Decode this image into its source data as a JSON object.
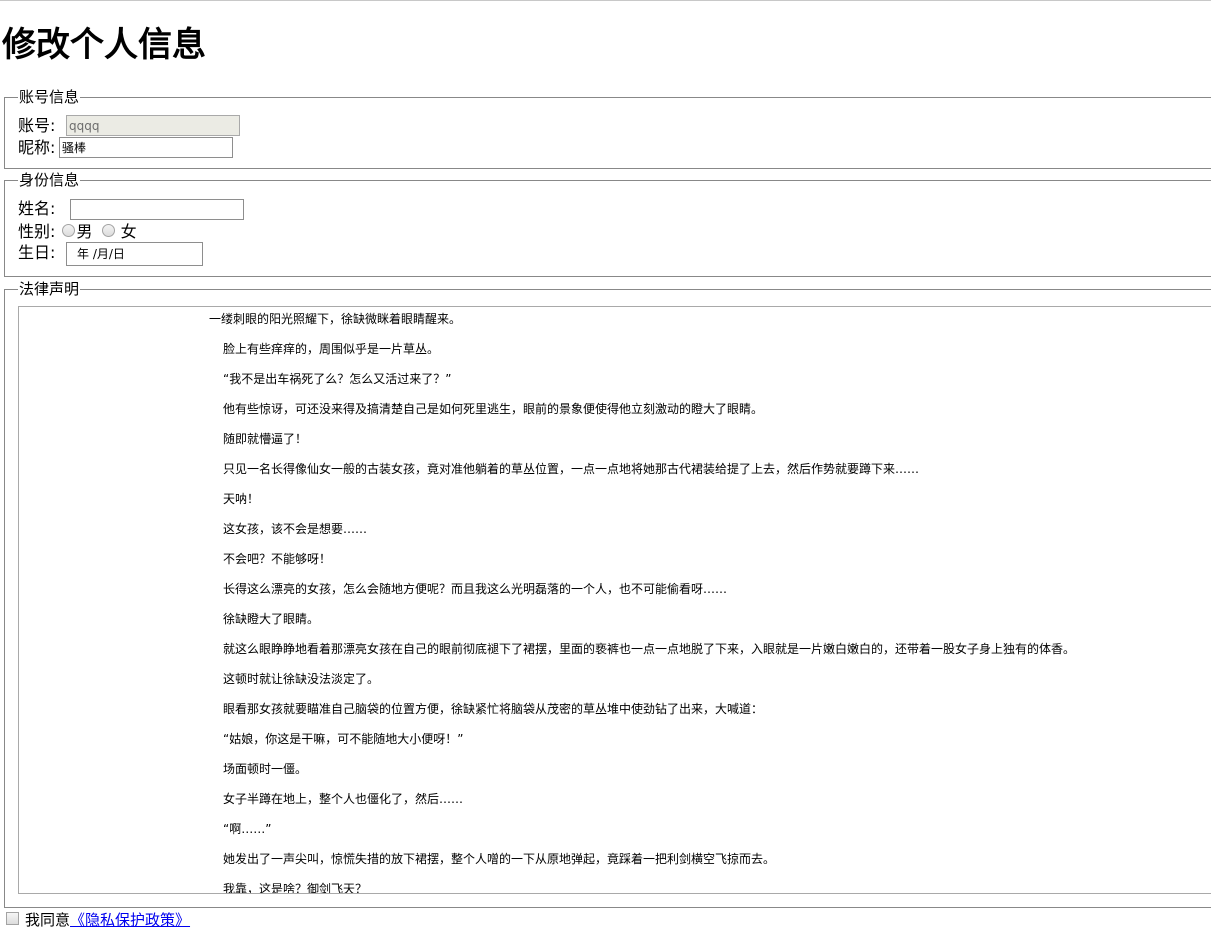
{
  "page": {
    "title": "修改个人信息"
  },
  "account_section": {
    "legend": "账号信息",
    "account_label": "账号:",
    "account_value": "qqqq",
    "nickname_label": "昵称:",
    "nickname_value": "骚棒"
  },
  "identity_section": {
    "legend": "身份信息",
    "name_label": "姓名:",
    "name_value": "",
    "gender_label": "性别:",
    "gender_options": [
      "男",
      "女"
    ],
    "birthday_label": "生日:",
    "birthday_placeholder": "年 /月/日"
  },
  "legal_section": {
    "legend": "法律声明",
    "paragraphs": [
      "一缕刺眼的阳光照耀下，徐缺微眯着眼睛醒来。",
      "脸上有些痒痒的，周围似乎是一片草丛。",
      "“我不是出车祸死了么？怎么又活过来了？”",
      "他有些惊讶，可还没来得及搞清楚自己是如何死里逃生，眼前的景象便使得他立刻激动的瞪大了眼睛。",
      "随即就懵逼了！",
      "只见一名长得像仙女一般的古装女孩，竟对准他躺着的草丛位置，一点一点地将她那古代裙装给提了上去，然后作势就要蹲下来……",
      "天呐！",
      "这女孩，该不会是想要……",
      "不会吧？不能够呀！",
      "长得这么漂亮的女孩，怎么会随地方便呢？而且我这么光明磊落的一个人，也不可能偷看呀……",
      "徐缺瞪大了眼睛。",
      "就这么眼睁睁地看着那漂亮女孩在自己的眼前彻底褪下了裙摆，里面的亵裤也一点一点地脱了下来，入眼就是一片嫩白嫩白的，还带着一股女子身上独有的体香。",
      "这顿时就让徐缺没法淡定了。",
      "眼看那女孩就要瞄准自己脑袋的位置方便，徐缺紧忙将脑袋从茂密的草丛堆中使劲钻了出来，大喊道：",
      "“姑娘，你这是干嘛，可不能随地大小便呀！”",
      "场面顿时一僵。",
      "女子半蹲在地上，整个人也僵化了，然后……",
      "“啊……”",
      "她发出了一声尖叫，惊慌失措的放下裙摆，整个人噌的一下从原地弹起，竟踩着一把利剑横空飞掠而去。",
      "我靠，这是啥？御剑飞天？"
    ]
  },
  "agreement": {
    "label": "我同意",
    "policy_link": "《隐私保护政策》"
  }
}
